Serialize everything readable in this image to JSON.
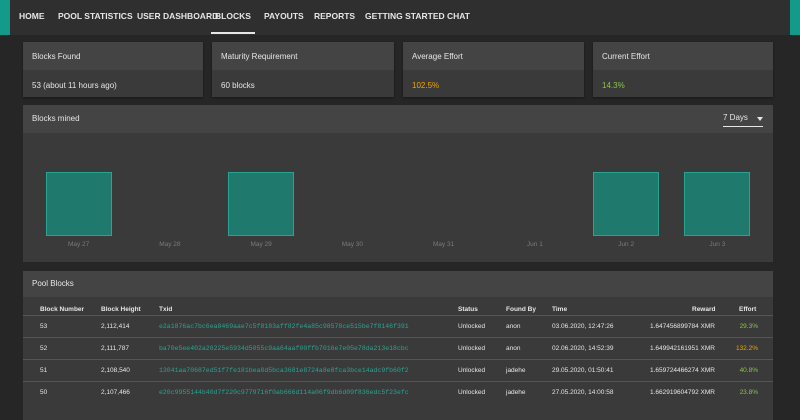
{
  "nav": {
    "tabs": [
      {
        "label": "HOME"
      },
      {
        "label": "POOL STATISTICS"
      },
      {
        "label": "USER DASHBOARD"
      },
      {
        "label": "BLOCKS",
        "active": true
      },
      {
        "label": "PAYOUTS"
      },
      {
        "label": "REPORTS"
      },
      {
        "label": "GETTING STARTED"
      },
      {
        "label": "CHAT"
      }
    ]
  },
  "cards": [
    {
      "title": "Blocks Found",
      "value": "53 (about 11 hours ago)"
    },
    {
      "title": "Maturity Requirement",
      "value": "60 blocks"
    },
    {
      "title": "Average Effort",
      "value": "102.5%"
    },
    {
      "title": "Current Effort",
      "value": "14.3%"
    }
  ],
  "colors": {
    "accent": "#139a8a",
    "bar_fill": "#1f7a6d",
    "effort_orange": "#f0a500",
    "effort_green": "#8bc34a"
  },
  "chart": {
    "title": "Blocks mined",
    "range_label": "7 Days"
  },
  "chart_data": {
    "type": "bar",
    "title": "Blocks mined",
    "categories": [
      "May 27",
      "May 28",
      "May 29",
      "May 30",
      "May 31",
      "Jun 1",
      "Jun 2",
      "Jun 3"
    ],
    "values": [
      1,
      0,
      1,
      0,
      0,
      0,
      1,
      1
    ],
    "xlabel": "",
    "ylabel": "",
    "ylim": [
      0,
      1.5
    ],
    "grid": false
  },
  "pool_blocks": {
    "title": "Pool Blocks",
    "columns": [
      "Block Number",
      "Block Height",
      "Txid",
      "Status",
      "Found By",
      "Time",
      "Reward",
      "Effort"
    ],
    "rows": [
      {
        "number": "53",
        "height": "2,112,414",
        "txid": "e2a1876ac7bc6ea8469aae7c5f8183aff82fe4a85c98578ce515be7f8146f391",
        "status": "Unlocked",
        "found_by": "anon",
        "time": "03.06.2020, 12:47:26",
        "reward": "1.647456899784 XMR",
        "effort": "29.3%",
        "effort_color": "#8bc34a"
      },
      {
        "number": "52",
        "height": "2,111,787",
        "txid": "ba70e5ee402a26225e5934d5055c9aa64aaf00ffb7016e7e05e78da213e18cbc",
        "status": "Unlocked",
        "found_by": "anon",
        "time": "02.06.2020, 14:52:39",
        "reward": "1.649942161951 XMR",
        "effort": "132.2%",
        "effort_color": "#f0a500"
      },
      {
        "number": "51",
        "height": "2,108,540",
        "txid": "13041aa70687ed51f7fe181bea8d5bca3681e8724a8e8fca3bce14adc9fb60f2",
        "status": "Unlocked",
        "found_by": "jadehe",
        "time": "29.05.2020, 01:50:41",
        "reward": "1.659724466274 XMR",
        "effort": "40.8%",
        "effort_color": "#8bc34a"
      },
      {
        "number": "50",
        "height": "2,107,466",
        "txid": "e20c9955144b40d7f220c9779716f0ab666d114a06f9db6d09f836edc5f23efc",
        "status": "Unlocked",
        "found_by": "jadehe",
        "time": "27.05.2020, 14:00:58",
        "reward": "1.662919604792 XMR",
        "effort": "23.8%",
        "effort_color": "#8bc34a"
      }
    ]
  }
}
